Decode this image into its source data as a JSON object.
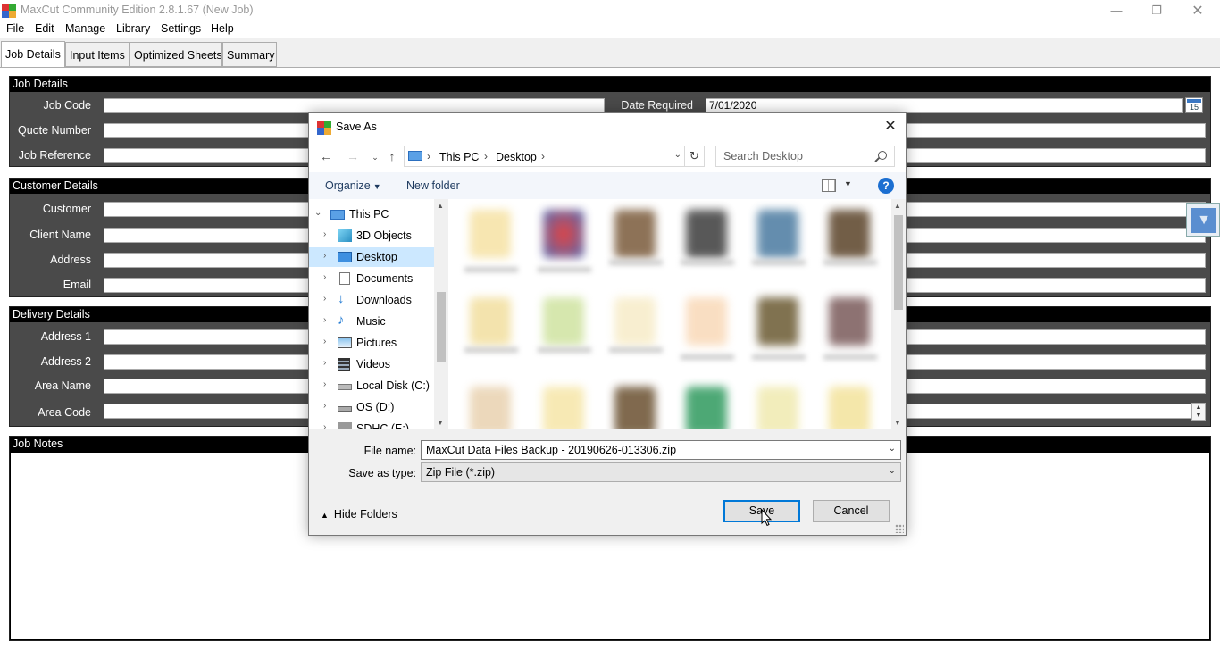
{
  "window": {
    "title": "MaxCut Community Edition 2.8.1.67 (New Job)"
  },
  "menu": [
    "File",
    "Edit",
    "Manage",
    "Library",
    "Settings",
    "Help"
  ],
  "tabs": [
    "Job Details",
    "Input Items",
    "Optimized Sheets",
    "Summary"
  ],
  "job_details": {
    "heading": "Job Details",
    "job_code": "Job Code",
    "quote_number": "Quote Number",
    "job_reference": "Job Reference",
    "date_required_label": "Date Required",
    "date_required_value": "7/01/2020",
    "calendar_icon_text": "15"
  },
  "customer_details": {
    "heading": "Customer Details",
    "customer": "Customer",
    "client_name": "Client Name",
    "address": "Address",
    "email": "Email"
  },
  "delivery_details": {
    "heading": "Delivery Details",
    "address1": "Address 1",
    "address2": "Address 2",
    "area_name": "Area Name",
    "area_code": "Area Code"
  },
  "job_notes": {
    "heading": "Job Notes"
  },
  "dialog": {
    "title": "Save As",
    "breadcrumb": [
      "This PC",
      "Desktop"
    ],
    "search_placeholder": "Search Desktop",
    "organize": "Organize",
    "new_folder": "New folder",
    "help": "?",
    "tree": [
      {
        "label": "This PC",
        "icon": "pc-icon"
      },
      {
        "label": "3D Objects",
        "icon": "cube-icon"
      },
      {
        "label": "Desktop",
        "icon": "desktop-icon"
      },
      {
        "label": "Documents",
        "icon": "document-icon"
      },
      {
        "label": "Downloads",
        "icon": "download-icon"
      },
      {
        "label": "Music",
        "icon": "music-icon"
      },
      {
        "label": "Pictures",
        "icon": "pictures-icon"
      },
      {
        "label": "Videos",
        "icon": "videos-icon"
      },
      {
        "label": "Local Disk (C:)",
        "icon": "drive-icon"
      },
      {
        "label": "OS (D:)",
        "icon": "drive-icon"
      },
      {
        "label": "SDHC (E:)",
        "icon": "sd-card-icon"
      }
    ],
    "file_name_label": "File name:",
    "file_name_value": "MaxCut Data Files Backup - 20190626-013306.zip",
    "save_type_label": "Save as type:",
    "save_type_value": "Zip File (*.zip)",
    "hide_folders": "Hide Folders",
    "save_button": "Save",
    "cancel_button": "Cancel"
  },
  "colors": {
    "accent": "#0078d7",
    "panel_bg": "#4a4a4a",
    "panel_head": "#000000",
    "selection": "#cce8ff"
  }
}
